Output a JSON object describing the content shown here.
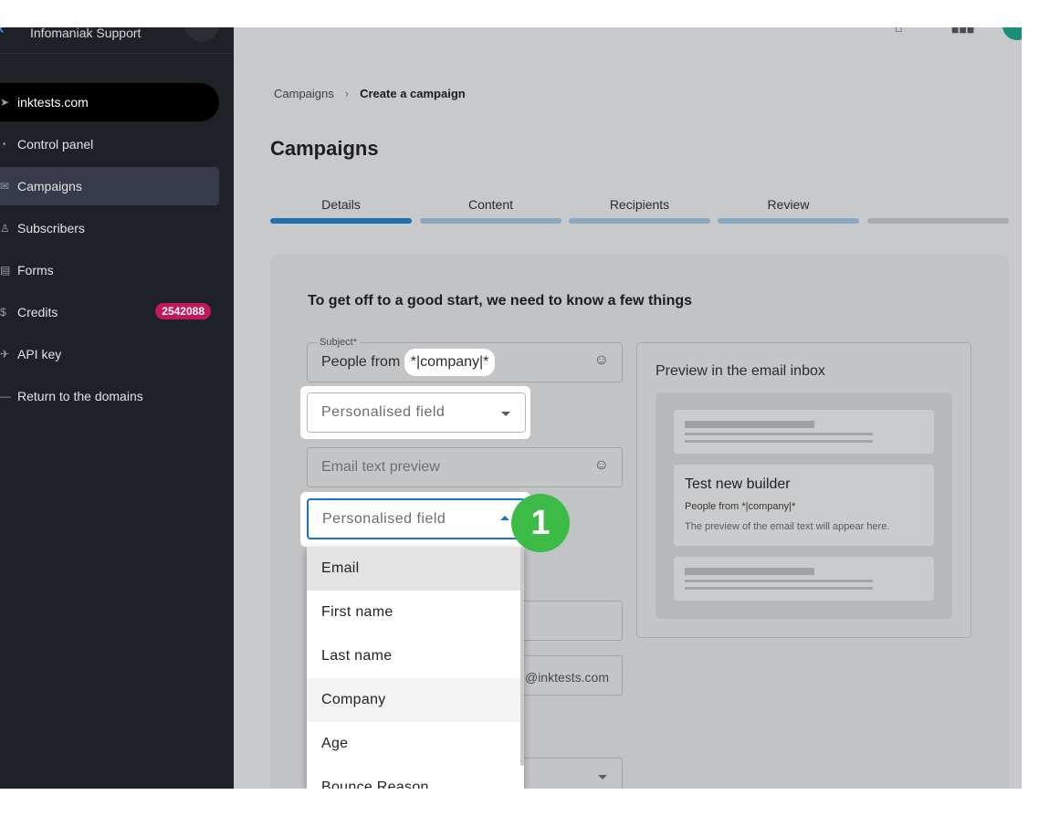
{
  "sidebar": {
    "org": "Infomaniak Support",
    "domain": "inktests.com",
    "items": [
      {
        "label": "Control panel",
        "icon": "gauge-icon"
      },
      {
        "label": "Campaigns",
        "icon": "mail-icon"
      },
      {
        "label": "Subscribers",
        "icon": "people-icon"
      },
      {
        "label": "Forms",
        "icon": "form-icon"
      },
      {
        "label": "Credits",
        "icon": "money-bag-icon",
        "badge": "2542088"
      },
      {
        "label": "API key",
        "icon": "rocket-icon"
      },
      {
        "label": "Return to the domains",
        "icon": "dash-icon"
      }
    ]
  },
  "breadcrumb": {
    "parent": "Campaigns",
    "current": "Create a campaign"
  },
  "page_title": "Campaigns",
  "steps": [
    "Details",
    "Content",
    "Recipients",
    "Review"
  ],
  "form": {
    "heading": "To get off to a good start, we need to know a few things",
    "subject_label": "Subject*",
    "subject_prefix": "People from",
    "subject_tag": "*|company|*",
    "personalised_1": "Personalised field",
    "email_preview_placeholder": "Email text preview",
    "personalised_2": "Personalised field",
    "sender_suffix": "@inktests.com",
    "step_marker": "1"
  },
  "dropdown": {
    "options": [
      "Email",
      "First name",
      "Last name",
      "Company",
      "Age",
      "Bounce Reason"
    ]
  },
  "preview": {
    "title": "Preview in the email inbox",
    "name": "Test new builder",
    "subject": "People from *|company|*",
    "text": "The preview of the email text will appear here."
  },
  "colors": {
    "accent": "#1d72c9",
    "badge": "#c2185b",
    "marker": "#3dbb47"
  }
}
